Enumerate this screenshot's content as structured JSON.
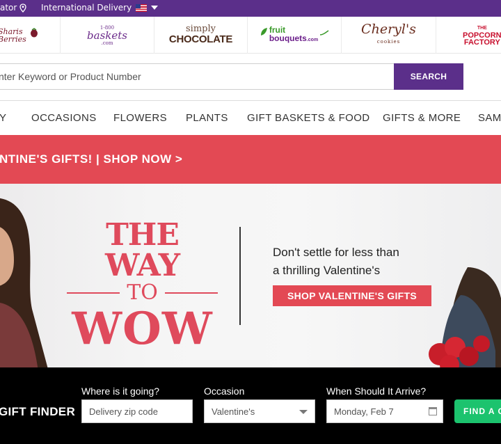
{
  "topbar": {
    "locator_label": "ator",
    "international_label": "International Delivery"
  },
  "brands": [
    {
      "top": "Sharis",
      "bottom": "Berries"
    },
    {
      "small": "1-800",
      "big": "baskets",
      "suffix": ".com"
    },
    {
      "top": "simply",
      "bottom": "CHOCOLATE"
    },
    {
      "top": "fruit",
      "bottom": "bouquets",
      "suffix": ".com"
    },
    {
      "top": "Cheryl's",
      "bottom": "cookies"
    },
    {
      "small": "THE",
      "top": "POPCORN",
      "bottom": "FACTORY"
    }
  ],
  "search": {
    "placeholder": "nter Keyword or Product Number",
    "button_label": "SEARCH"
  },
  "nav": {
    "items": [
      "Y",
      "OCCASIONS",
      "FLOWERS",
      "PLANTS",
      "GIFT BASKETS & FOOD",
      "GIFTS & MORE",
      "SAM"
    ]
  },
  "promo": {
    "text": "NTINE'S GIFTS! | SHOP NOW >"
  },
  "hero": {
    "headline_1": "THE WAY",
    "headline_2": "TO",
    "headline_3": "WOW",
    "tagline_1": "Don't settle for less than",
    "tagline_2": "a thrilling Valentine's",
    "cta_label": "SHOP VALENTINE'S GIFTS"
  },
  "finder": {
    "title": "GIFT FINDER",
    "zip_label": "Where is it going?",
    "zip_placeholder": "Delivery zip code",
    "occasion_label": "Occasion",
    "occasion_value": "Valentine's",
    "date_label": "When Should It Arrive?",
    "date_value": "Monday, Feb 7",
    "button_label": "FIND A G"
  },
  "colors": {
    "brand_purple": "#5b2f8a",
    "promo_red": "#e34954",
    "headline_red": "#df4a5c",
    "finder_bg": "#000000",
    "find_button_green": "#1cc36e"
  }
}
